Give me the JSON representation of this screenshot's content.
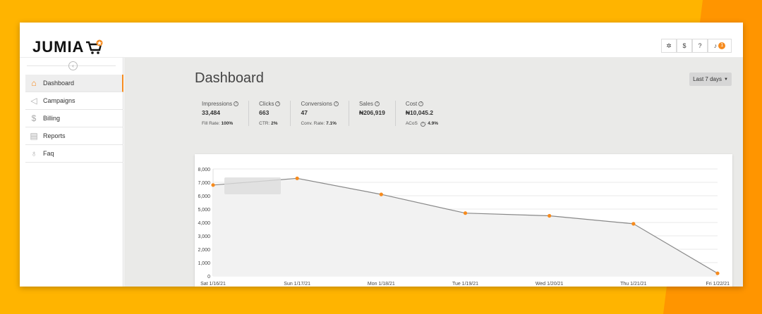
{
  "brand": {
    "logo_text": "JUMIA"
  },
  "topbar": {
    "icons": [
      "gear-icon",
      "dollar-icon",
      "help-icon",
      "bell-icon"
    ],
    "notification_count": "1"
  },
  "sidebar": {
    "items": [
      {
        "label": "Dashboard",
        "icon": "home-icon",
        "active": true
      },
      {
        "label": "Campaigns",
        "icon": "megaphone-icon",
        "active": false
      },
      {
        "label": "Billing",
        "icon": "dollar-icon",
        "active": false
      },
      {
        "label": "Reports",
        "icon": "document-icon",
        "active": false
      },
      {
        "label": "Faq",
        "icon": "bulb-icon",
        "active": false
      }
    ]
  },
  "main": {
    "title": "Dashboard",
    "range_button": "Last 7 days"
  },
  "metrics": [
    {
      "label": "Impressions",
      "value": "33,484",
      "sub_label": "Fill Rate:",
      "sub_value": "100%"
    },
    {
      "label": "Clicks",
      "value": "663",
      "sub_label": "CTR:",
      "sub_value": "2%"
    },
    {
      "label": "Conversions",
      "value": "47",
      "sub_label": "Conv. Rate:",
      "sub_value": "7.1%"
    },
    {
      "label": "Sales",
      "value": "₦206,919",
      "sub_label": "",
      "sub_value": ""
    },
    {
      "label": "Cost",
      "value": "₦10,045.2",
      "sub_label": "ACoS",
      "sub_value": "4.9%"
    }
  ],
  "colors": {
    "accent": "#F68B1E",
    "background": "#FFB400",
    "line": "#888888"
  },
  "chart_data": {
    "type": "area",
    "x": [
      "Sat 1/16/21",
      "Sun 1/17/21",
      "Mon 1/18/21",
      "Tue 1/19/21",
      "Wed 1/20/21",
      "Thu 1/21/21",
      "Fri 1/22/21"
    ],
    "series": [
      {
        "values": [
          6800,
          7300,
          6100,
          4700,
          4500,
          3900,
          200
        ]
      }
    ],
    "y_ticks": [
      "0",
      "1,000",
      "2,000",
      "3,000",
      "4,000",
      "5,000",
      "6,000",
      "7,000",
      "8,000"
    ],
    "ylim": [
      0,
      8000
    ],
    "grid": true
  }
}
